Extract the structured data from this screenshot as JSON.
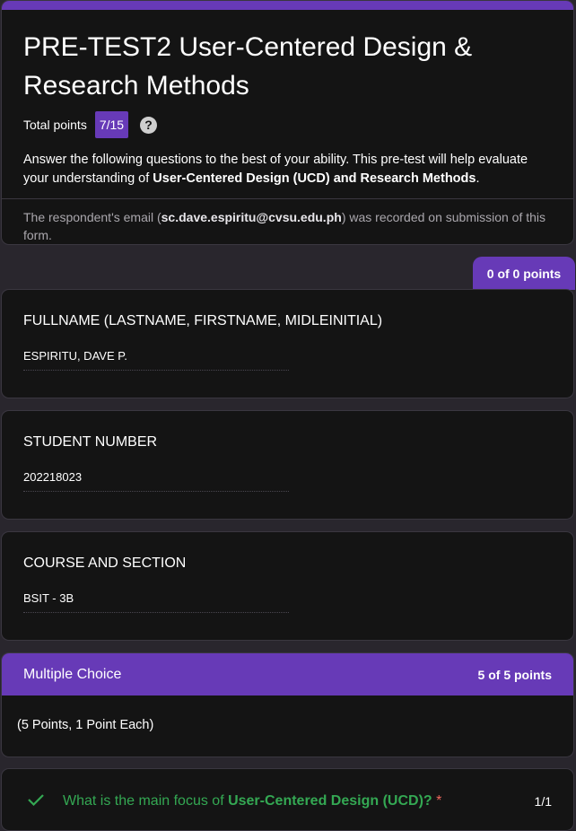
{
  "form": {
    "title": "PRE-TEST2 User-Centered Design & Research Methods",
    "total_points_label": "Total points",
    "total_points_value": "7/15",
    "description_part1": " Answer the following questions to the best of your ability. This pre-test will help evaluate your understanding of ",
    "description_bold": "User-Centered Design (UCD) and Research Methods",
    "description_part2": ".",
    "email_prefix": "The respondent's email (",
    "email": "sc.dave.espiritu@cvsu.edu.ph",
    "email_suffix": ") was recorded on submission of this form."
  },
  "section1": {
    "points": "0 of 0 points"
  },
  "questions": [
    {
      "title": "FULLNAME (LASTNAME, FIRSTNAME, MIDLEINITIAL)",
      "answer": "ESPIRITU, DAVE P."
    },
    {
      "title": "STUDENT NUMBER",
      "answer": "202218023"
    },
    {
      "title": "COURSE AND SECTION",
      "answer": "BSIT - 3B"
    }
  ],
  "multiple_choice": {
    "title": "Multiple Choice",
    "points": "5 of 5 points",
    "description": "(5 Points, 1 Point Each)"
  },
  "q1": {
    "prefix": "What is the main focus of ",
    "bold": "User-Centered Design (UCD)",
    "suffix": "?",
    "required_mark": "*",
    "score": "1/1"
  },
  "colors": {
    "accent": "#673ab7",
    "correct": "#34a853",
    "required": "#ee675c",
    "background": "#29262d",
    "card": "#141414"
  },
  "icons": {
    "help": "help-circle-icon",
    "check": "check-icon"
  }
}
